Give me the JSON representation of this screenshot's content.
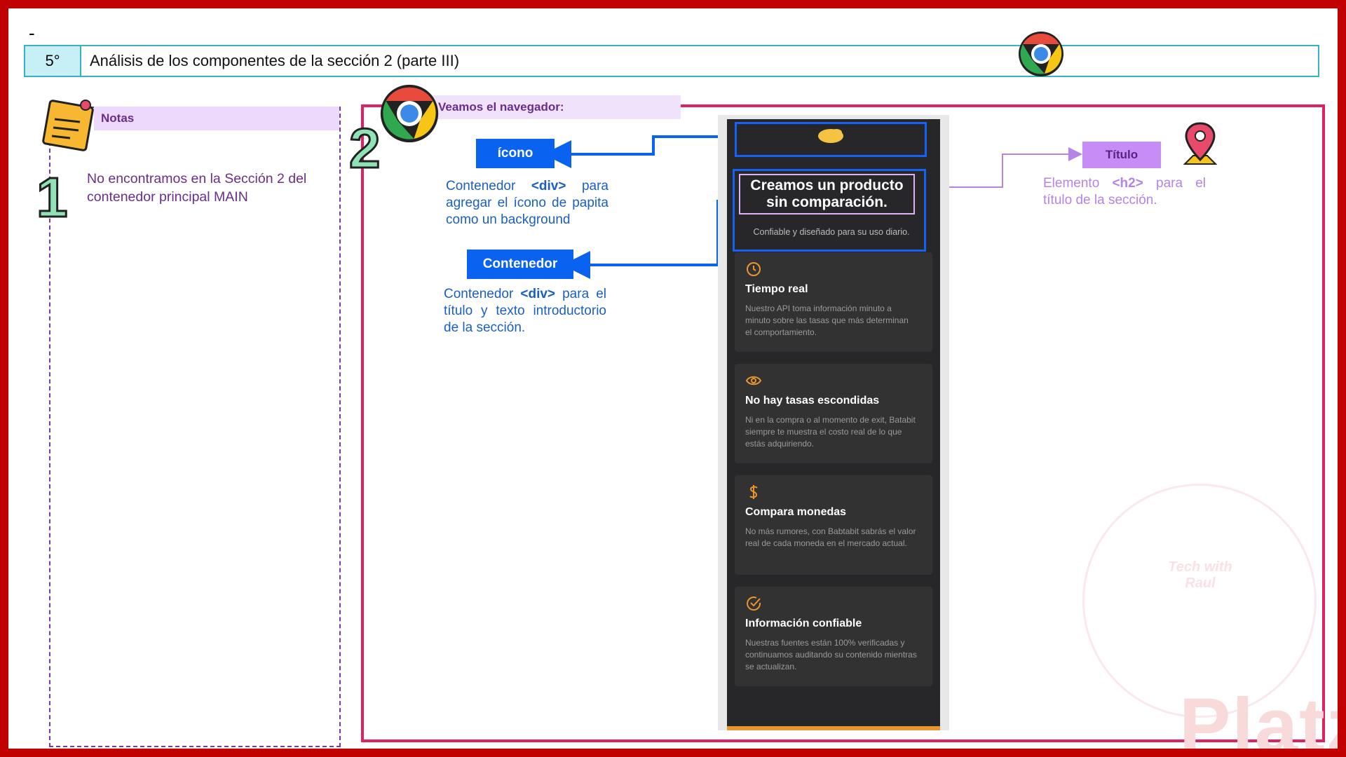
{
  "slide": {
    "dash": "-",
    "number": "5°",
    "title": "Análisis de los componentes de la sección 2 (parte III)"
  },
  "notes": {
    "label": "Notas",
    "step": "1",
    "text": "No encontramos en la Sección 2 del contenedor principal MAIN"
  },
  "browser": {
    "step": "2",
    "label": "Veamos el navegador:"
  },
  "annotations": {
    "icono": {
      "tag": "ícono",
      "desc_pre": "Contenedor ",
      "desc_code": "<div>",
      "desc_post": " para agregar el ícono de papita como un background"
    },
    "contenedor": {
      "tag": "Contenedor",
      "desc_pre": "Contenedor ",
      "desc_code": "<div>",
      "desc_post": " para el título y texto introductorio de la sección."
    },
    "titulo": {
      "tag": "Título",
      "desc_pre": "Elemento ",
      "desc_code": "<h2>",
      "desc_post": " para el título de la sección."
    }
  },
  "phone": {
    "heading": "Creamos un producto sin comparación.",
    "subtitle": "Confiable y diseñado para su uso diario.",
    "cards": [
      {
        "icon": "clock-icon",
        "title": "Tiempo real",
        "desc": "Nuestro API toma información minuto a minuto sobre las tasas que más determinan el comportamiento."
      },
      {
        "icon": "eye-icon",
        "title": "No hay tasas escondidas",
        "desc": "Ni en la compra o al momento de exit, Batabit siempre te muestra el costo real de lo que estás adquiriendo."
      },
      {
        "icon": "dollar-icon",
        "title": "Compara monedas",
        "desc": "No más rumores, con Babtabit sabrás el valor real de cada moneda en el mercado actual."
      },
      {
        "icon": "check-circle-icon",
        "title": "Información confiable",
        "desc": "Nuestras fuentes están 100% verificadas y continuamos auditando su contenido mientras se actualizan."
      }
    ]
  },
  "watermark": {
    "brand": "Platzi",
    "logo_text": "Tech with Raul"
  },
  "colors": {
    "frame_red": "#c10000",
    "accent_pink": "#e0215f",
    "blue": "#0a63f0",
    "purple": "#6a2d8c",
    "lilac": "#b683e6",
    "orange": "#e8962d"
  }
}
